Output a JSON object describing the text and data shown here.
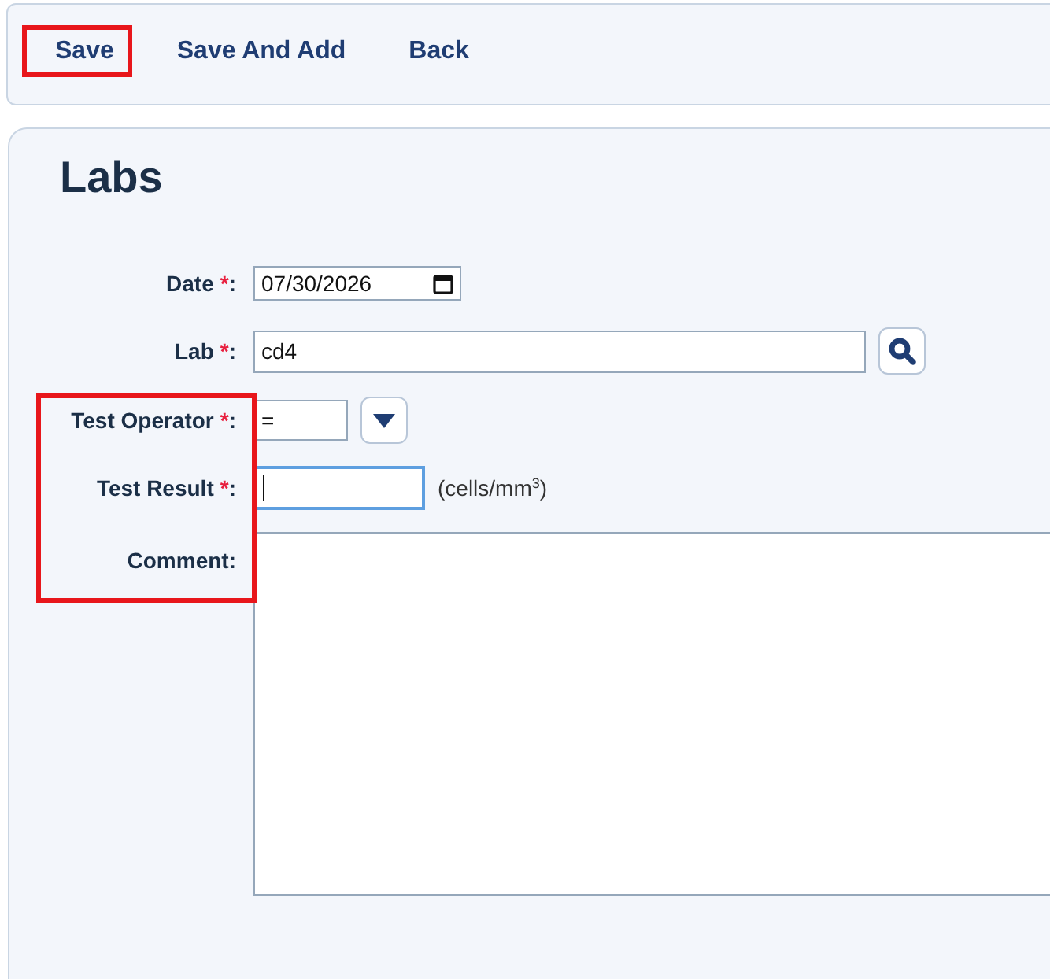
{
  "toolbar": {
    "buttons": [
      {
        "label": "Save",
        "highlighted": true
      },
      {
        "label": "Save And Add",
        "highlighted": false
      },
      {
        "label": "Back",
        "highlighted": false
      }
    ]
  },
  "form": {
    "title": "Labs",
    "fields": [
      {
        "kind": "date",
        "label": "Date",
        "required_mark": "*",
        "colon": ":",
        "value": "07/30/2026",
        "focused": false,
        "highlighted": false
      },
      {
        "kind": "lookup",
        "label": "Lab",
        "required_mark": "*",
        "colon": ":",
        "value": "cd4",
        "focused": false,
        "highlighted": false
      },
      {
        "kind": "select",
        "label": "Test Operator",
        "required_mark": "*",
        "colon": ":",
        "value": "=",
        "focused": false,
        "highlighted": true
      },
      {
        "kind": "number",
        "label": "Test Result",
        "required_mark": "*",
        "colon": ":",
        "focused": true,
        "unit": "(cells/mm$^{3}$)",
        "highlighted": true
      },
      {
        "kind": "textarea",
        "label": "Comment",
        "colon": ":",
        "focused": false,
        "highlighted": true
      }
    ]
  }
}
